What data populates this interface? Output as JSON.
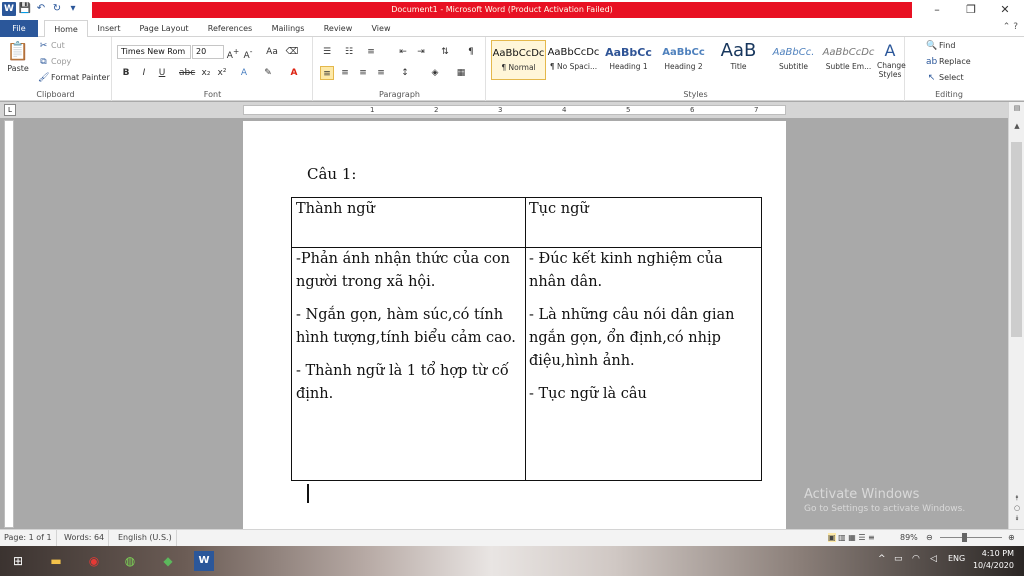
{
  "titlebar": {
    "title": "Document1 - Microsoft Word (Product Activation Failed)",
    "minimize": "–",
    "restore": "❐",
    "close": "✕"
  },
  "tabs": {
    "file": "File",
    "items": [
      "Home",
      "Insert",
      "Page Layout",
      "References",
      "Mailings",
      "Review",
      "View"
    ]
  },
  "ribbon": {
    "clipboard": {
      "label": "Clipboard",
      "paste": "Paste",
      "cut": "Cut",
      "copy": "Copy",
      "format_painter": "Format Painter"
    },
    "font": {
      "label": "Font",
      "name": "Times New Rom",
      "size": "20"
    },
    "paragraph": {
      "label": "Paragraph"
    },
    "styles": {
      "label": "Styles",
      "items": [
        {
          "preview": "AaBbCcDc",
          "name": "¶ Normal"
        },
        {
          "preview": "AaBbCcDc",
          "name": "¶ No Spaci..."
        },
        {
          "preview": "AaBbCc",
          "name": "Heading 1"
        },
        {
          "preview": "AaBbCc",
          "name": "Heading 2"
        },
        {
          "preview": "AaB",
          "name": "Title"
        },
        {
          "preview": "AaBbCc.",
          "name": "Subtitle"
        },
        {
          "preview": "AaBbCcDc",
          "name": "Subtle Em..."
        }
      ],
      "change_styles": "Change Styles"
    },
    "editing": {
      "label": "Editing",
      "find": "Find",
      "replace": "Replace",
      "select": "Select"
    }
  },
  "ruler": {
    "numbers": [
      "1",
      "2",
      "3",
      "4",
      "5",
      "6",
      "7"
    ]
  },
  "document": {
    "heading": "Câu 1:",
    "table": {
      "headers": [
        "Thành ngữ",
        "Tục ngữ"
      ],
      "left": [
        "-Phản ánh nhận thức của con người trong xã hội.",
        "- Ngắn gọn, hàm súc,có tính hình tượng,tính biểu cảm cao.",
        "- Thành ngữ là 1 tổ hợp từ cố định."
      ],
      "right": [
        "- Đúc kết kinh nghiệm của nhân dân.",
        "- Là những câu nói dân gian ngắn gọn, ổn định,có nhịp điệu,hình ảnh.",
        "- Tục ngữ là câu"
      ]
    }
  },
  "watermark": {
    "line1": "Activate Windows",
    "line2": "Go to Settings to activate Windows."
  },
  "statusbar": {
    "page": "Page: 1 of 1",
    "words": "Words: 64",
    "language": "English (U.S.)",
    "zoom": "89%"
  },
  "taskbar": {
    "language": "ENG",
    "time": "4:10 PM",
    "date": "10/4/2020"
  }
}
